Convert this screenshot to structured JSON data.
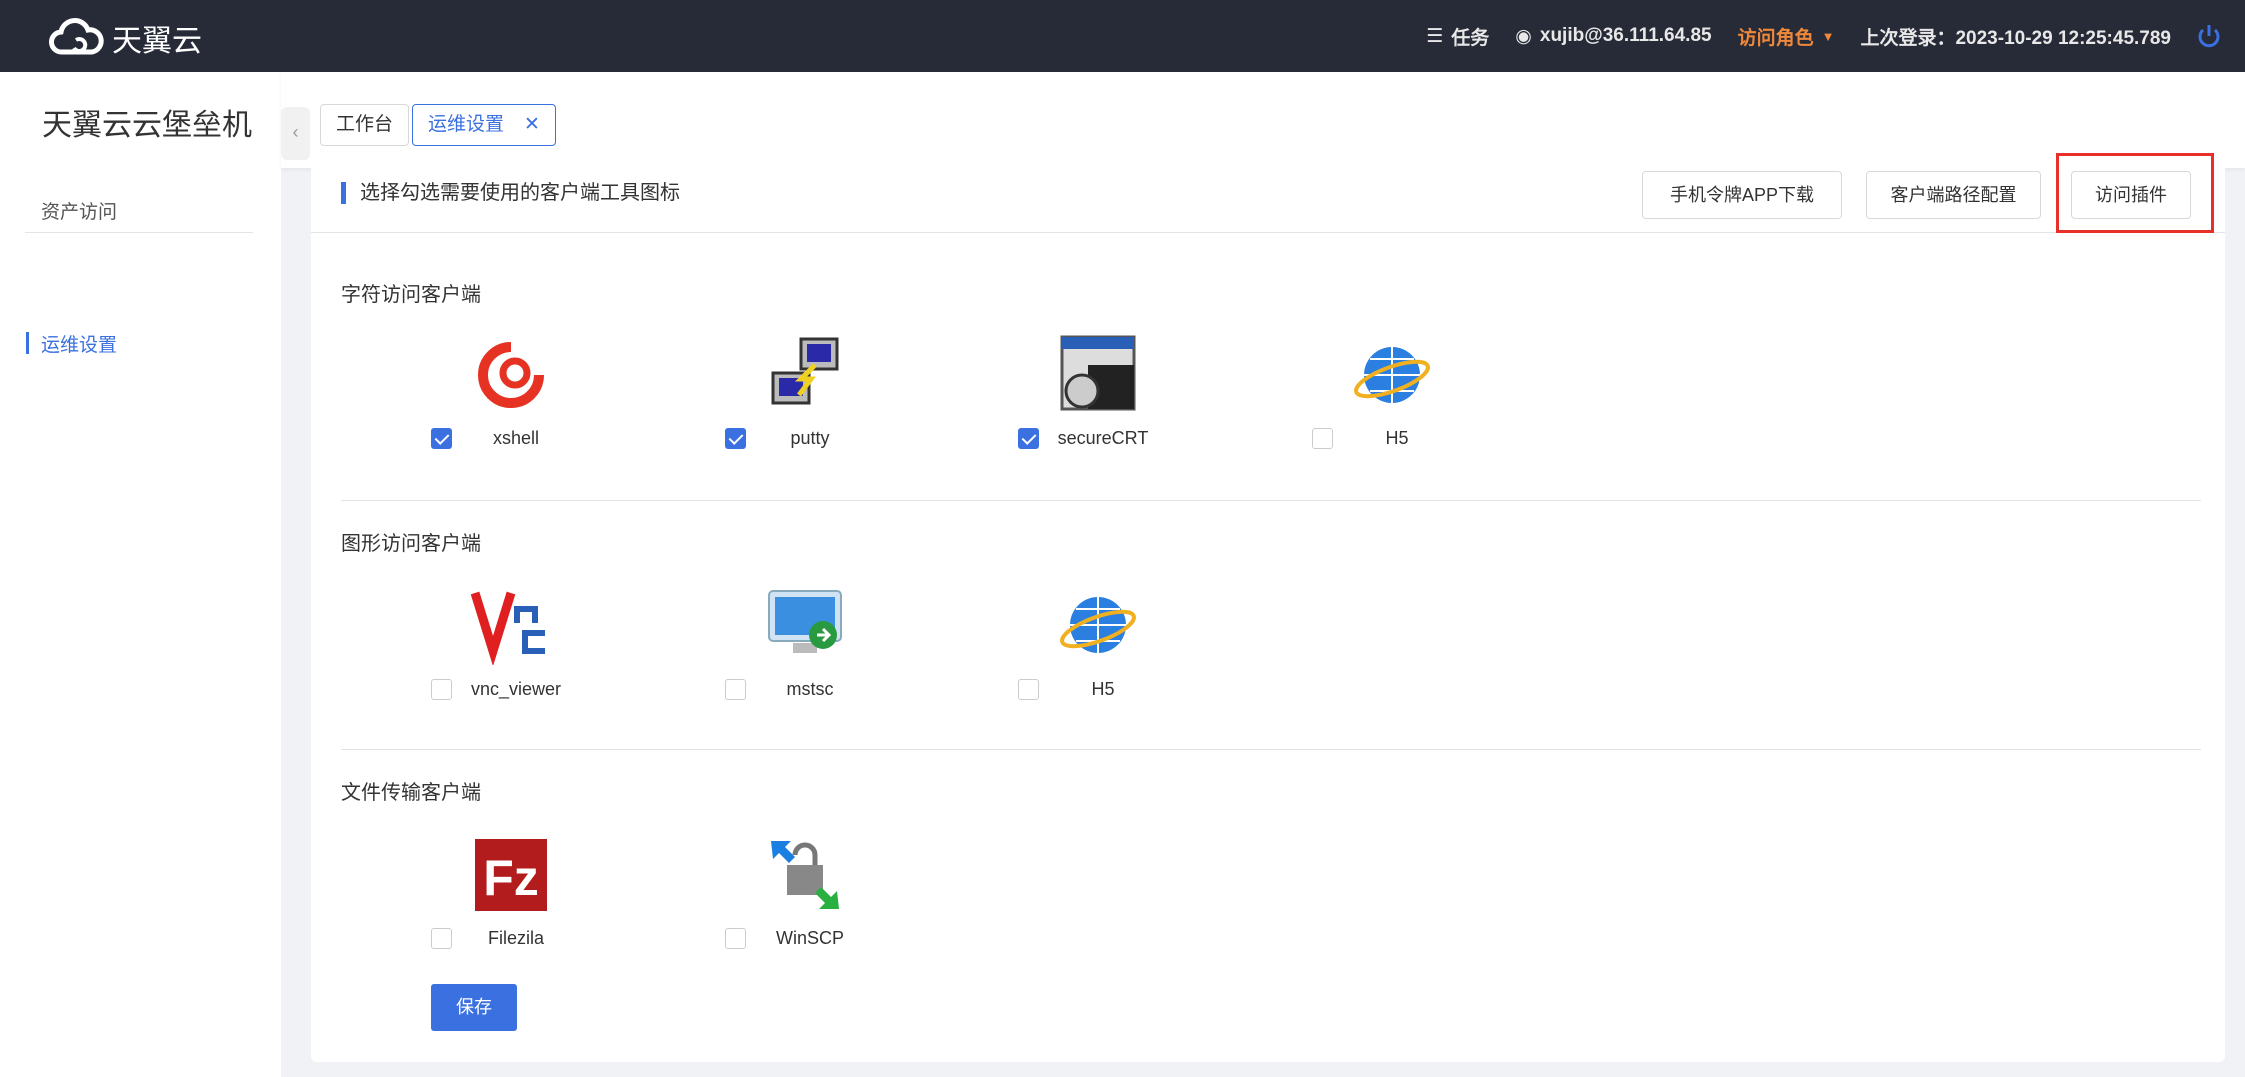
{
  "header": {
    "brand": "天翼云",
    "tasks": "任务",
    "user": "xujib@36.111.64.85",
    "role": "访问角色",
    "last_login": "上次登录：2023-10-29 12:25:45.789"
  },
  "sidebar": {
    "title": "天翼云云堡垒机",
    "items": [
      {
        "label": "资产访问"
      },
      {
        "label": "运维设置",
        "active": true
      }
    ]
  },
  "tabs": [
    {
      "label": "工作台"
    },
    {
      "label": "运维设置",
      "closable": true
    }
  ],
  "card": {
    "title": "选择勾选需要使用的客户端工具图标",
    "buttons": [
      "手机令牌APP下载",
      "客户端路径配置",
      "访问插件"
    ],
    "save": "保存",
    "sections": [
      {
        "title": "字符访问客户端",
        "clients": [
          {
            "name": "xshell",
            "checked": true
          },
          {
            "name": "putty",
            "checked": true
          },
          {
            "name": "secureCRT",
            "checked": true
          },
          {
            "name": "H5",
            "checked": false
          }
        ]
      },
      {
        "title": "图形访问客户端",
        "clients": [
          {
            "name": "vnc_viewer",
            "checked": false
          },
          {
            "name": "mstsc",
            "checked": false
          },
          {
            "name": "H5",
            "checked": false
          }
        ]
      },
      {
        "title": "文件传输客户端",
        "clients": [
          {
            "name": "Filezila",
            "checked": false
          },
          {
            "name": "WinSCP",
            "checked": false
          }
        ]
      }
    ]
  },
  "colors": {
    "accent": "#3a70e0",
    "header_bg": "#272b38",
    "role": "#f0883a",
    "highlight": "#e8302a"
  }
}
